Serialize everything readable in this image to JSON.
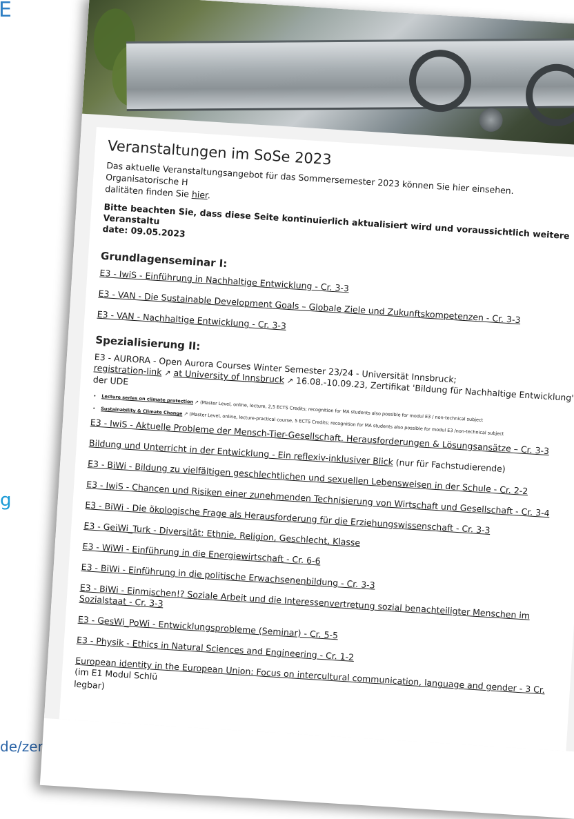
{
  "slide": {
    "top_fragment": "E",
    "mid_fragment": "g",
    "url_fragment": "de/zertifikat-bne"
  },
  "page": {
    "title": "Veranstaltungen im SoSe 2023",
    "intro": "Das aktuelle Veranstaltungsangebot für das Sommersemester 2023 können Sie hier einsehen. Organisatorische H",
    "intro_line2_prefix": "dalitäten finden Sie ",
    "intro_link": "hier",
    "intro_line2_suffix": ".",
    "notice": "Bitte beachten Sie, dass diese Seite kontinuierlich aktualisiert wird und voraussichtlich weitere Veranstaltu",
    "notice_date": "date: 09.05.2023"
  },
  "section1": {
    "heading": "Grundlagenseminar I:",
    "courses": [
      "E3 - IwiS - Einführung in Nachhaltige Entwicklung - Cr. 3-3",
      "E3 - VAN - Die Sustainable Development Goals – Globale Ziele und Zukunftskompetenzen - Cr. 3-3",
      "E3 - VAN - Nachhaltige Entwicklung - Cr. 3-3"
    ]
  },
  "section2": {
    "heading": "Spezialisierung II:",
    "aurora_line": "E3 - AURORA - Open Aurora Courses Winter Semester 23/24 - Universität Innsbruck;",
    "aurora_link1": "registration-link",
    "aurora_link2": "at University of Innsbruck",
    "aurora_rest": " 16.08.-10.09.23, Zertifikat 'Bildung für Nachhaltige Entwicklung' der UDE",
    "sub_items": [
      {
        "link": "Lecture series on climate protection",
        "text": " (Master Level, online, lecture, 2,5 ECTS Credits; recognition for MA students also possible for modul E3 / non-technical subject"
      },
      {
        "link": "Sustainability & Climate Change",
        "text": " (Master Level, online, lecture-practical course, 5 ECTS Credits; recognition for MA students also possible for modul E3 /non-technical subject"
      }
    ],
    "courses": [
      {
        "link": "E3 - IwiS - Aktuelle Probleme der Mensch-Tier-Gesellschaft. Herausforderungen & Lösungsansätze – Cr. 3-3",
        "suffix": ""
      },
      {
        "link": "Bildung und Unterricht in der Entwicklung - Ein reflexiv-inklusiver Blick",
        "suffix": " (nur für Fachstudierende)"
      },
      {
        "link": "E3 - BiWi - Bildung zu vielfältigen geschlechtlichen und sexuellen Lebensweisen in der Schule - Cr. 2-2",
        "suffix": ""
      },
      {
        "link": "E3 - IwiS - Chancen und Risiken einer zunehmenden Technisierung von Wirtschaft und Gesellschaft - Cr. 3-4",
        "suffix": ""
      },
      {
        "link": "E3 - BiWi - Die ökologische Frage als Herausforderung für die Erziehungswissenschaft - Cr. 3-3",
        "suffix": ""
      },
      {
        "link": "E3 - GeiWi_Turk - Diversität: Ethnie, Religion, Geschlecht, Klasse",
        "suffix": ""
      },
      {
        "link": "E3 - WiWi - Einführung in die Energiewirtschaft - Cr. 6-6",
        "suffix": ""
      },
      {
        "link": "E3 - BiWi - Einführung in die politische Erwachsenenbildung - Cr. 3-3",
        "suffix": ""
      },
      {
        "link": "E3 - BiWi - Einmischen!? Soziale Arbeit und die Interessenvertretung sozial benachteiligter Menschen im Sozialstaat - Cr. 3-3",
        "suffix": ""
      },
      {
        "link": "E3 - GesWi_PoWi - Entwicklungsprobleme (Seminar) - Cr. 5-5",
        "suffix": ""
      },
      {
        "link": "E3 - Physik - Ethics in Natural Sciences and Engineering - Cr. 1-2",
        "suffix": ""
      },
      {
        "link": "European identity in the European Union: Focus on intercultural communication, language and gender - 3 Cr.",
        "suffix": " (im E1 Modul Schlü"
      }
    ],
    "trailing": "legbar)"
  }
}
